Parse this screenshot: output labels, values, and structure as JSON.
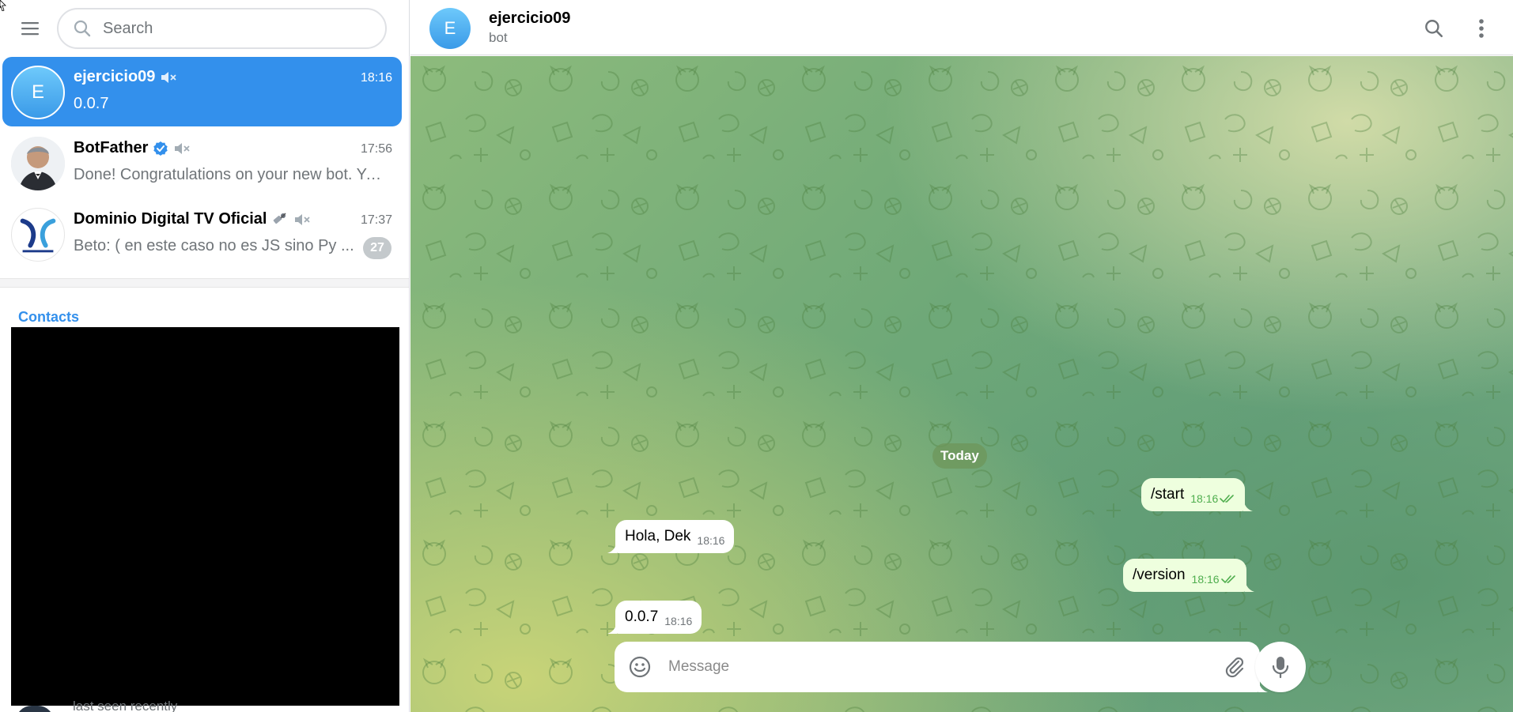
{
  "sidebar": {
    "search_placeholder": "Search",
    "chats": [
      {
        "title": "ejercicio09",
        "avatar_letter": "E",
        "time": "18:16",
        "preview": "0.0.7",
        "muted": true,
        "active": true
      },
      {
        "title": "BotFather",
        "time": "17:56",
        "preview": "Done! Congratulations on your new bot. You will find it at t.me/...",
        "verified": true,
        "muted": true
      },
      {
        "title": "Dominio Digital TV Oficial",
        "time": "17:37",
        "preview": "Beto: ( en este caso no es JS sino Py ...",
        "badge": "27",
        "muted": true
      }
    ],
    "contacts_label": "Contacts",
    "contact_status": "last seen recently"
  },
  "chat": {
    "header": {
      "title": "ejercicio09",
      "subtitle": "bot",
      "avatar_letter": "E"
    },
    "date_label": "Today",
    "messages": [
      {
        "direction": "out",
        "text": "/start",
        "time": "18:16"
      },
      {
        "direction": "in",
        "text": "Hola, Dek",
        "time": "18:16"
      },
      {
        "direction": "out",
        "text": "/version",
        "time": "18:16"
      },
      {
        "direction": "in",
        "text": "0.0.7",
        "time": "18:16"
      }
    ],
    "composer_placeholder": "Message"
  },
  "colors": {
    "accent": "#3390ec",
    "outgoing_bubble": "#eeffde",
    "read_check": "#4fae4e"
  }
}
